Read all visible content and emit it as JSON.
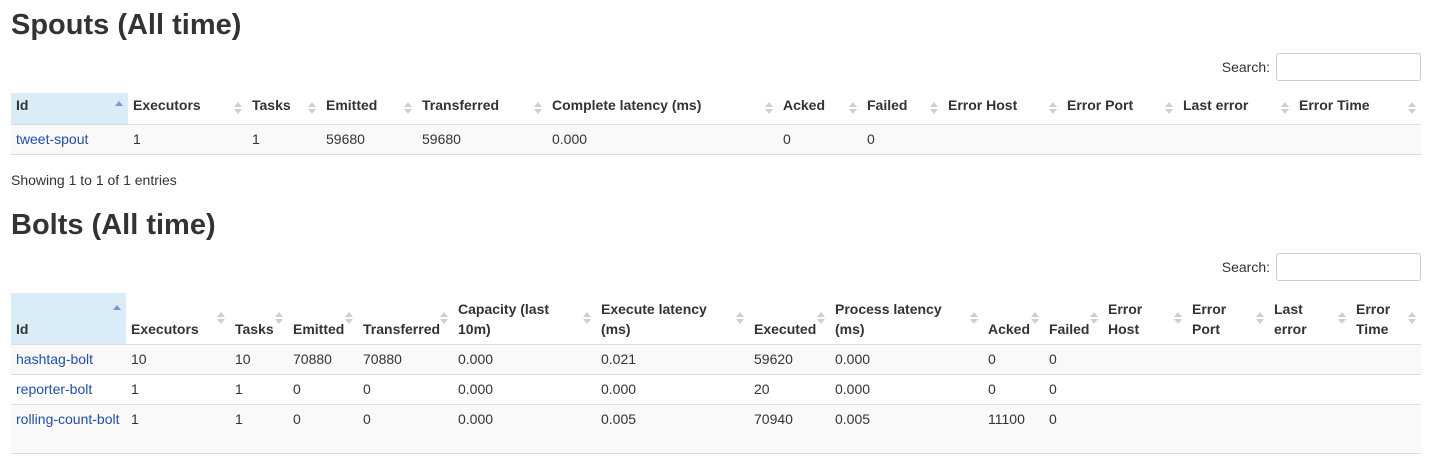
{
  "spouts": {
    "title": "Spouts (All time)",
    "search_label": "Search:",
    "search_value": "",
    "columns": [
      "Id",
      "Executors",
      "Tasks",
      "Emitted",
      "Transferred",
      "Complete latency (ms)",
      "Acked",
      "Failed",
      "Error Host",
      "Error Port",
      "Last error",
      "Error Time"
    ],
    "rows": [
      [
        "tweet-spout",
        "1",
        "1",
        "59680",
        "59680",
        "0.000",
        "0",
        "0",
        "",
        "",
        "",
        ""
      ]
    ],
    "info": "Showing 1 to 1 of 1 entries"
  },
  "bolts": {
    "title": "Bolts (All time)",
    "search_label": "Search:",
    "search_value": "",
    "columns": [
      "Id",
      "Executors",
      "Tasks",
      "Emitted",
      "Transferred",
      "Capacity (last 10m)",
      "Execute latency (ms)",
      "Executed",
      "Process latency (ms)",
      "Acked",
      "Failed",
      "Error Host",
      "Error Port",
      "Last error",
      "Error Time"
    ],
    "rows": [
      [
        "hashtag-bolt",
        "10",
        "10",
        "70880",
        "70880",
        "0.000",
        "0.021",
        "59620",
        "0.000",
        "0",
        "0",
        "",
        "",
        "",
        ""
      ],
      [
        "reporter-bolt",
        "1",
        "1",
        "0",
        "0",
        "0.000",
        "0.000",
        "20",
        "0.000",
        "0",
        "0",
        "",
        "",
        "",
        ""
      ],
      [
        "rolling-count-bolt",
        "1",
        "1",
        "0",
        "0",
        "0.000",
        "0.005",
        "70940",
        "0.005",
        "11100",
        "0",
        "",
        "",
        "",
        ""
      ]
    ]
  },
  "colors": {
    "link": "#1f4fa6",
    "sorted_header_bg": "#d9ecf7",
    "sort_active": "#8b8ed8",
    "row_stripe": "#f9f9f9"
  }
}
